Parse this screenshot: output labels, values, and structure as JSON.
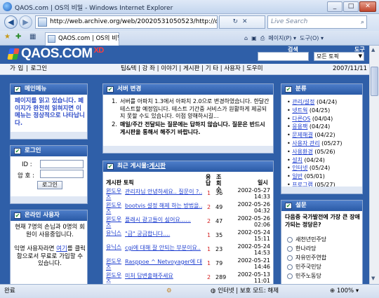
{
  "window": {
    "title": "QAOS.com | OS의 비밀 - Windows Internet Explorer",
    "min_label": "_",
    "max_label": "□",
    "close_label": "✕"
  },
  "address_bar": {
    "url": "http://web.archive.org/web/20020531050523/http://qaos.com/",
    "search_placeholder": "Live Search"
  },
  "tab": {
    "label": "QAOS.com | OS의 비밀"
  },
  "command_bar": {
    "page_label": "페이지(P) ▾",
    "tools_label": "도구(O) ▾"
  },
  "site": {
    "logo_text": "QAOS.COM",
    "logo_suffix": "XD",
    "search_label": "검색",
    "tools_label": "도구",
    "search_scope": "모든 토픽",
    "menu": {
      "join": "가 입",
      "login": "로그인",
      "items": [
        "팁&텍",
        "강 좌",
        "이야기",
        "게시판",
        "기 타",
        "사용자",
        "도우미"
      ],
      "date": "2007/11/11"
    }
  },
  "main_menu": {
    "title": "메인메뉴",
    "text": "페이지를 읽고 있습니다. 페이지가 완전히 읽혀지면 이 메뉴는 정상적으로 나타납니다."
  },
  "login": {
    "title": "로그인",
    "id_label": "ID :",
    "pw_label": "암 호 :",
    "button": "로그인"
  },
  "online": {
    "title": "온라인 사용자",
    "text1": "현재 7명의 손님과 0명의 회원이 사용중입니다.",
    "text2_pre": "익명 사용자라면 ",
    "text2_link": "여기",
    "text2_post": "를 클릭함으로서 무료로 가입할 수 있습니다."
  },
  "server_notice": {
    "title": "서버 변경",
    "item1": "서버를 아파치 1.3에서 아파치 2.0으로 변경하였습니다. 한달간 테스트할 예정입니다. 테스트 기간중 서비스가 원활하게 제공되지 못할 수도 있습니다. 이점 양해하시길...",
    "item2": "매일/주간 전달되는 질문에는 답하지 않습니다. 질문은 반드시 게시판을 통해서 해주기 바랍니다."
  },
  "board": {
    "title_pre": "최근 게시물:",
    "title_link": "게시판",
    "headers": {
      "topic": "게시판 토픽",
      "replies": "응답",
      "views": "조회수",
      "date": "일시"
    },
    "rows": [
      {
        "cat": "윈도우즈",
        "topic": "관리자님 안녕하세요.. 질문이 ?..",
        "replies": "1",
        "views": "36",
        "date": "2002-05-27",
        "time": "14:33"
      },
      {
        "cat": "윈도우즈",
        "topic": "bootvis 설정 해제 하는 방법을..",
        "replies": "2",
        "views": "49",
        "date": "2002-05-26",
        "time": "04:32"
      },
      {
        "cat": "윈도우즈",
        "topic": "플래시 광고들이 싫어요......",
        "replies": "2",
        "views": "47",
        "date": "2002-05-26",
        "time": "02:06"
      },
      {
        "cat": "유닉스",
        "topic": "\"급\" 궁금합니다....",
        "replies": "1",
        "views": "35",
        "date": "2002-05-24",
        "time": "15:11"
      },
      {
        "cat": "유닉스",
        "topic": "cgi에 대해 잘 안되는 부분이요..",
        "replies": "1",
        "views": "23",
        "date": "2002-05-24",
        "time": "14:53"
      },
      {
        "cat": "윈도우즈",
        "topic": "Rasppoe ^ Netvoyager에 대하여",
        "replies": "1",
        "views": "79",
        "date": "2002-05-21",
        "time": "14:46"
      },
      {
        "cat": "윈도우즈",
        "topic": "미처 답변출해주세요",
        "replies": "2",
        "views": "289",
        "date": "2002-05-13",
        "time": "11:01"
      }
    ]
  },
  "categories": {
    "title": "분류",
    "items": [
      {
        "name": "관리/설정",
        "date": "(04/24)"
      },
      {
        "name": "넷트웍",
        "date": "(04/25)"
      },
      {
        "name": "다른OS",
        "date": "(04/04)"
      },
      {
        "name": "응용팩",
        "date": "(04/24)"
      },
      {
        "name": "문제해결",
        "date": "(04/22)"
      },
      {
        "name": "사용자 관리",
        "date": "(05/27)"
      },
      {
        "name": "사용환경",
        "date": "(05/26)"
      },
      {
        "name": "설치",
        "date": "(04/24)"
      },
      {
        "name": "인터넷",
        "date": "(05/24)"
      },
      {
        "name": "일반",
        "date": "(05/01)"
      },
      {
        "name": "프로그램",
        "date": "(05/27)"
      }
    ]
  },
  "poll": {
    "title": "설문",
    "question": "다음중 국가발전에 가장 큰 장애가되는 정당은?",
    "options": [
      "새천년민주당",
      "한나라당",
      "자유민주연합",
      "민주국민당",
      "민주노동당"
    ]
  },
  "status": {
    "left": "완료",
    "zone": "인터넷 | 보호 모드: 해제",
    "zoom": "100%"
  },
  "colors": {
    "site_blue": "#2f5fa8",
    "box_header": "#2a5aa6",
    "notice_red": "#d42020"
  }
}
